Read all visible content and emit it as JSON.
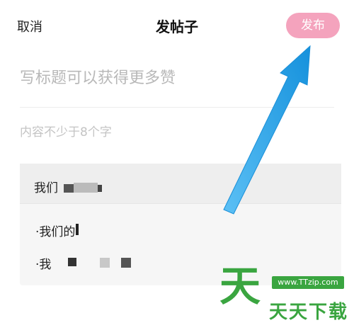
{
  "nav": {
    "cancel_label": "取消",
    "title": "发帖子",
    "publish_label": "发布"
  },
  "form": {
    "title_placeholder": "写标题可以获得更多赞",
    "content_placeholder": "内容不少于8个字"
  },
  "draft_card": {
    "header_text": "我们",
    "items": [
      "·我们的",
      "·我"
    ]
  },
  "watermark": {
    "logo_char": "天",
    "url": "www.TTzip.com",
    "text": "天天下载"
  },
  "colors": {
    "publish_button": "#f4a3bd",
    "arrow": "#2fa8ea",
    "watermark": "#3aa540"
  }
}
